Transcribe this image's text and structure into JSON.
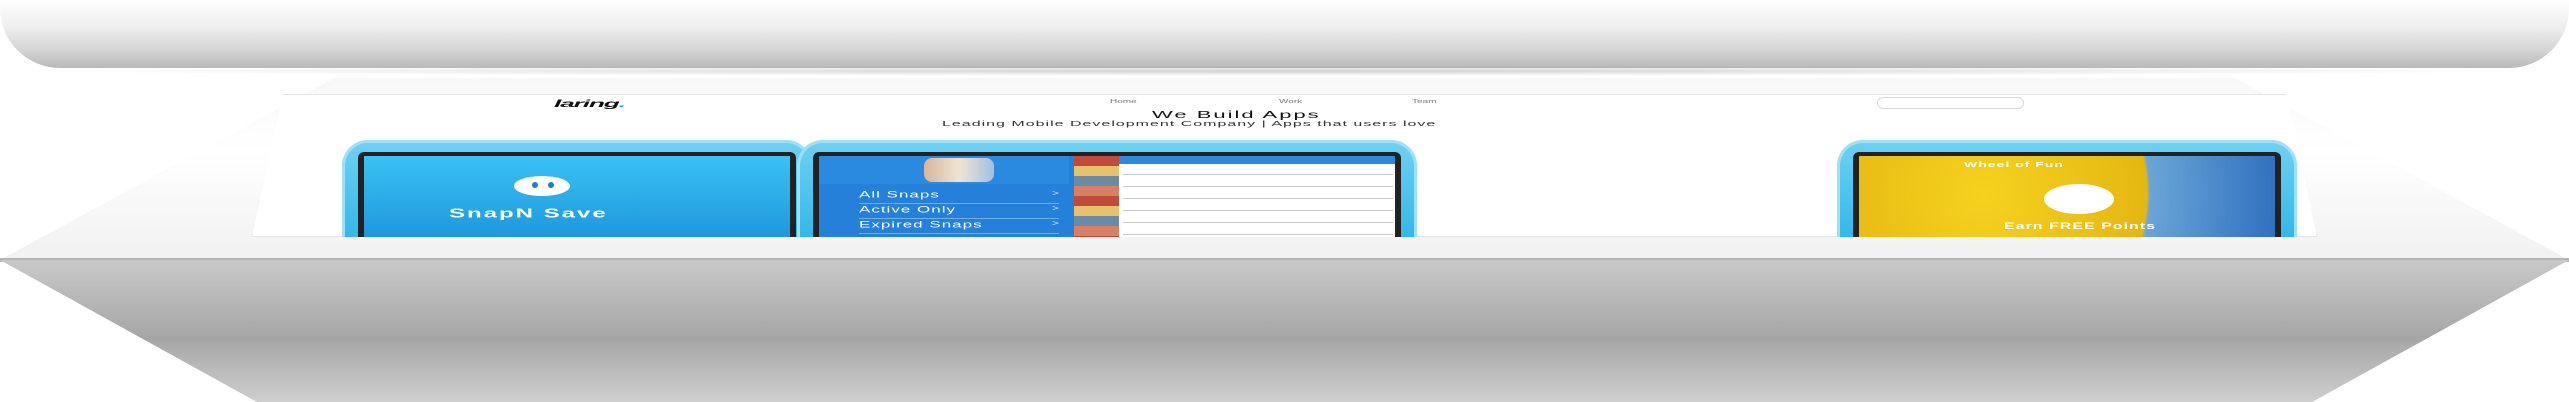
{
  "brand": {
    "logo_text": "laring",
    "logo_dot": "."
  },
  "nav": {
    "items": [
      "Home",
      "Work",
      "Team"
    ]
  },
  "hero": {
    "headline": "We Build Apps",
    "subline": "Leading Mobile Development Company | Apps that users love"
  },
  "phones": {
    "left": {
      "label": "SnapN Save"
    },
    "center": {
      "menu": [
        {
          "label": "All Snaps",
          "arrow": ">"
        },
        {
          "label": "Active Only",
          "arrow": ">"
        },
        {
          "label": "Expired Snaps",
          "arrow": ">"
        }
      ]
    },
    "right": {
      "title": "Wheel of Fun",
      "label": "Earn FREE Points"
    }
  },
  "colors": {
    "accent": "#1ca0e0",
    "phone_blue": "#2cb4e8",
    "app_blue": "#2480d9",
    "yellow": "#f6d21e"
  },
  "icons": [
    "ghost-icon",
    "chevron-right-icon",
    "device-camera-icon"
  ]
}
